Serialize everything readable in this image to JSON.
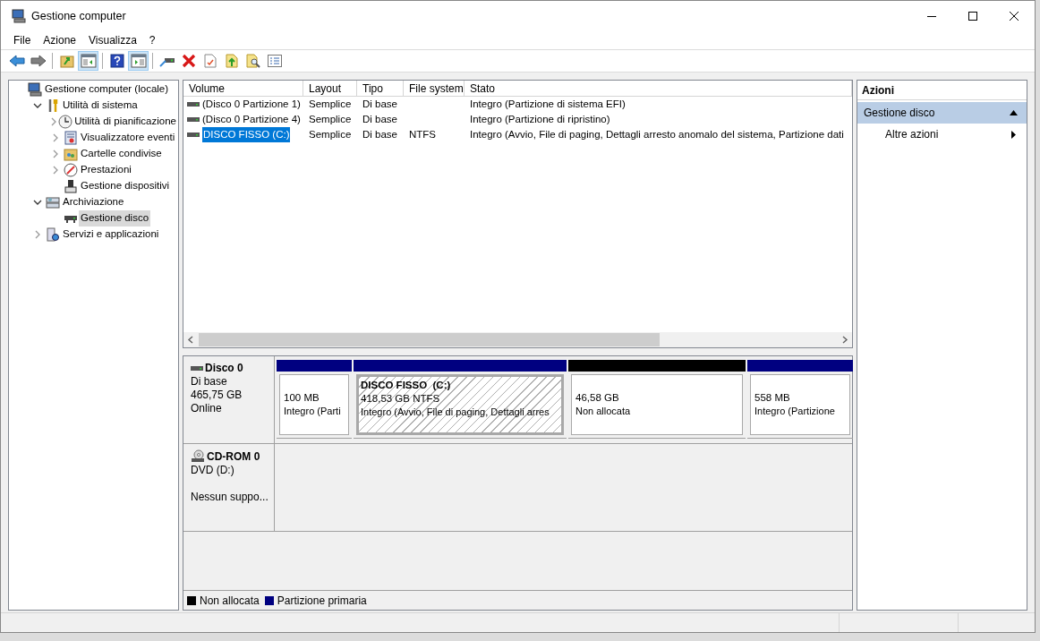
{
  "window": {
    "title": "Gestione computer"
  },
  "menu": [
    "File",
    "Azione",
    "Visualizza",
    "?"
  ],
  "toolbar": [
    {
      "kind": "back",
      "pressed": false
    },
    {
      "kind": "forward",
      "pressed": false
    },
    {
      "kind": "sep"
    },
    {
      "kind": "up",
      "pressed": false
    },
    {
      "kind": "tree",
      "pressed": true
    },
    {
      "kind": "sep"
    },
    {
      "kind": "help",
      "pressed": false
    },
    {
      "kind": "actionpane",
      "pressed": true
    },
    {
      "kind": "sep"
    },
    {
      "kind": "connect",
      "pressed": false
    },
    {
      "kind": "delete",
      "pressed": false
    },
    {
      "kind": "properties",
      "pressed": false
    },
    {
      "kind": "export",
      "pressed": false
    },
    {
      "kind": "find",
      "pressed": false
    },
    {
      "kind": "list",
      "pressed": false
    }
  ],
  "tree": [
    {
      "label": "Gestione computer (locale)",
      "kind": "computer",
      "selected": false,
      "children": [
        {
          "label": "Utilità di sistema",
          "kind": "tools",
          "expanded": true,
          "selected": false,
          "children": [
            {
              "label": "Utilità di pianificazione",
              "kind": "clock",
              "expanded": false,
              "selected": false
            },
            {
              "label": "Visualizzatore eventi",
              "kind": "events",
              "expanded": false,
              "selected": false
            },
            {
              "label": "Cartelle condivise",
              "kind": "folder",
              "expanded": false,
              "selected": false
            },
            {
              "label": "Prestazioni",
              "kind": "performance",
              "expanded": false,
              "selected": false
            },
            {
              "label": "Gestione dispositivi",
              "kind": "device",
              "selected": false
            }
          ]
        },
        {
          "label": "Archiviazione",
          "kind": "storage",
          "expanded": true,
          "selected": false,
          "children": [
            {
              "label": "Gestione disco",
              "kind": "disk",
              "selected": true
            }
          ]
        },
        {
          "label": "Servizi e applicazioni",
          "kind": "services",
          "expanded": false,
          "selected": false
        }
      ]
    }
  ],
  "volume_table": {
    "columns": [
      "Volume",
      "Layout",
      "Tipo",
      "File system",
      "Stato"
    ],
    "rows": [
      {
        "cells": [
          "(Disco 0 Partizione 1)",
          "Semplice",
          "Di base",
          "",
          "Integro (Partizione di sistema EFI)"
        ],
        "selected": false
      },
      {
        "cells": [
          "(Disco 0 Partizione 4)",
          "Semplice",
          "Di base",
          "",
          "Integro (Partizione di ripristino)"
        ],
        "selected": false
      },
      {
        "cells": [
          "DISCO FISSO (C:)",
          "Semplice",
          "Di base",
          "NTFS",
          "Integro (Avvio, File di paging, Dettagli arresto anomalo del sistema, Partizione dati"
        ],
        "selected": true
      }
    ]
  },
  "disks": [
    {
      "kind": "disk",
      "name": "Disco 0",
      "type": "Di base",
      "size": "465,75 GB",
      "status": "Online",
      "partitions": [
        {
          "kind": "primary",
          "size": "100 MB",
          "status": "Integro (Parti",
          "selected": false
        },
        {
          "kind": "primary",
          "title": "DISCO FISSO  (C:)",
          "size": "418,53 GB NTFS",
          "status": "Integro (Avvio, File di paging, Dettagli arres",
          "selected": true
        },
        {
          "kind": "unallocated",
          "size": "46,58 GB",
          "status": "Non allocata",
          "selected": false
        },
        {
          "kind": "primary",
          "size": "558 MB",
          "status": "Integro (Partizione",
          "selected": false
        }
      ]
    },
    {
      "kind": "cdrom",
      "name": "CD-ROM 0",
      "type": "DVD (D:)",
      "status": "Nessun suppo..."
    }
  ],
  "legend": [
    {
      "label": "Non allocata",
      "color": "#000000"
    },
    {
      "label": "Partizione primaria",
      "color": "#000080"
    }
  ],
  "actions": {
    "title": "Azioni",
    "sections": [
      {
        "label": "Gestione disco",
        "expanded": true,
        "items": [
          "Altre azioni"
        ]
      }
    ]
  }
}
